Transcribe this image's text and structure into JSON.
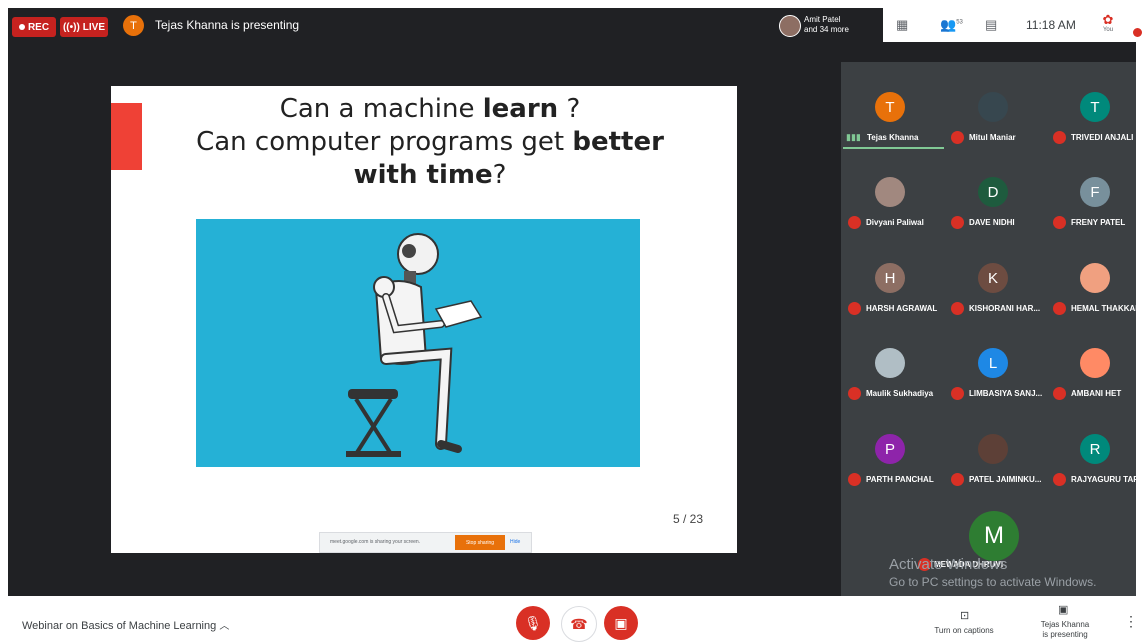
{
  "top": {
    "rec_label": "REC",
    "live_label": "LIVE",
    "presenter_initial": "T",
    "presenting_text": "Tejas Khanna is presenting",
    "others_line1": "Amit Patel",
    "others_line2": "and 34 more",
    "participant_count": "53",
    "time": "11:18 AM",
    "you_label": "You"
  },
  "slide": {
    "line1_a": "Can a machine ",
    "line1_b": "learn",
    "line1_c": " ?",
    "line2_a": "Can computer programs get ",
    "line2_b": "better",
    "line3_b": "with time",
    "line3_c": "?",
    "page": "5 / 23",
    "share_text": "meet.google.com is sharing your screen.",
    "stop_sharing": "Stop sharing",
    "hide": "Hide"
  },
  "participants": [
    {
      "name": "Tejas Khanna",
      "initial": "T",
      "color": "#e8710a"
    },
    {
      "name": "Mitul Maniar",
      "initial": "",
      "color": "#37474f"
    },
    {
      "name": "TRIVEDI ANJALI",
      "initial": "T",
      "color": "#00897b"
    },
    {
      "name": "Divyani Paliwal",
      "initial": "",
      "color": "#a1887f"
    },
    {
      "name": "DAVE NIDHI",
      "initial": "D",
      "color": "#1e5b3e"
    },
    {
      "name": "FRENY PATEL",
      "initial": "F",
      "color": "#78909c"
    },
    {
      "name": "HARSH AGRAWAL",
      "initial": "H",
      "color": "#8d6e63"
    },
    {
      "name": "KISHORANI HAR...",
      "initial": "K",
      "color": "#6d4c41"
    },
    {
      "name": "HEMAL THAKKAR",
      "initial": "",
      "color": "#f0a080"
    },
    {
      "name": "Maulik Sukhadiya",
      "initial": "",
      "color": "#b0bec5"
    },
    {
      "name": "LIMBASIYA SANJ...",
      "initial": "L",
      "color": "#1e88e5"
    },
    {
      "name": "AMBANI HET",
      "initial": "",
      "color": "#ff8a65"
    },
    {
      "name": "PARTH PANCHAL",
      "initial": "P",
      "color": "#8e24aa"
    },
    {
      "name": "PATEL JAIMINKU...",
      "initial": "",
      "color": "#5d4037"
    },
    {
      "name": "RAJYAGURU TARZ...",
      "initial": "R",
      "color": "#00897b"
    }
  ],
  "last_participant": {
    "name": "MEWADA DHRUVI",
    "initial": "M"
  },
  "watermark": {
    "line1": "Activate Windows",
    "line2": "Go to PC settings to activate Windows."
  },
  "bottom": {
    "meeting_title": "Webinar on Basics of Machine Learning",
    "captions": "Turn on captions",
    "presenting_line1": "Tejas Khanna",
    "presenting_line2": "is presenting"
  },
  "colors": {
    "accent": "#d93025",
    "slide_image_bg": "#25b1d6",
    "slide_accent": "#ef4136"
  }
}
